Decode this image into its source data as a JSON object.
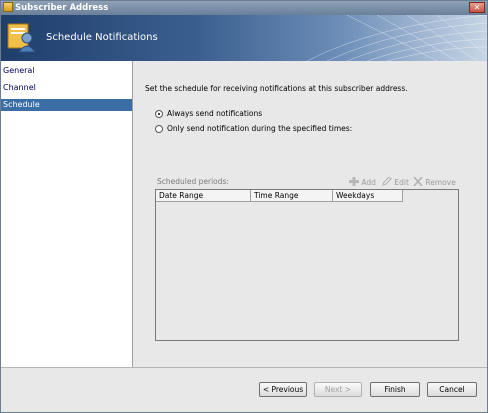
{
  "window": {
    "title": "Subscriber Address"
  },
  "banner": {
    "title": "Schedule Notifications"
  },
  "nav": {
    "items": [
      {
        "label": "General",
        "selected": false
      },
      {
        "label": "Channel",
        "selected": false
      },
      {
        "label": "Schedule",
        "selected": true
      }
    ]
  },
  "main": {
    "description": "Set the schedule for receiving notifications at this subscriber address.",
    "radio_always": "Always send notifications",
    "radio_specified": "Only send notification during the specified times:",
    "selected_option": "always",
    "periods_label": "Scheduled periods:",
    "add_label": "Add",
    "edit_label": "Edit",
    "remove_label": "Remove",
    "columns": [
      "Date Range",
      "Time Range",
      "Weekdays"
    ]
  },
  "footer": {
    "previous_label": "< Previous",
    "next_label": "Next >",
    "finish_label": "Finish",
    "cancel_label": "Cancel"
  },
  "colors": {
    "selection": "#3a6ea5",
    "banner_dark": "#1f3e6c"
  },
  "icons": [
    "app-icon",
    "close-icon",
    "schedule-banner-icon",
    "add-icon",
    "edit-icon",
    "remove-icon"
  ]
}
